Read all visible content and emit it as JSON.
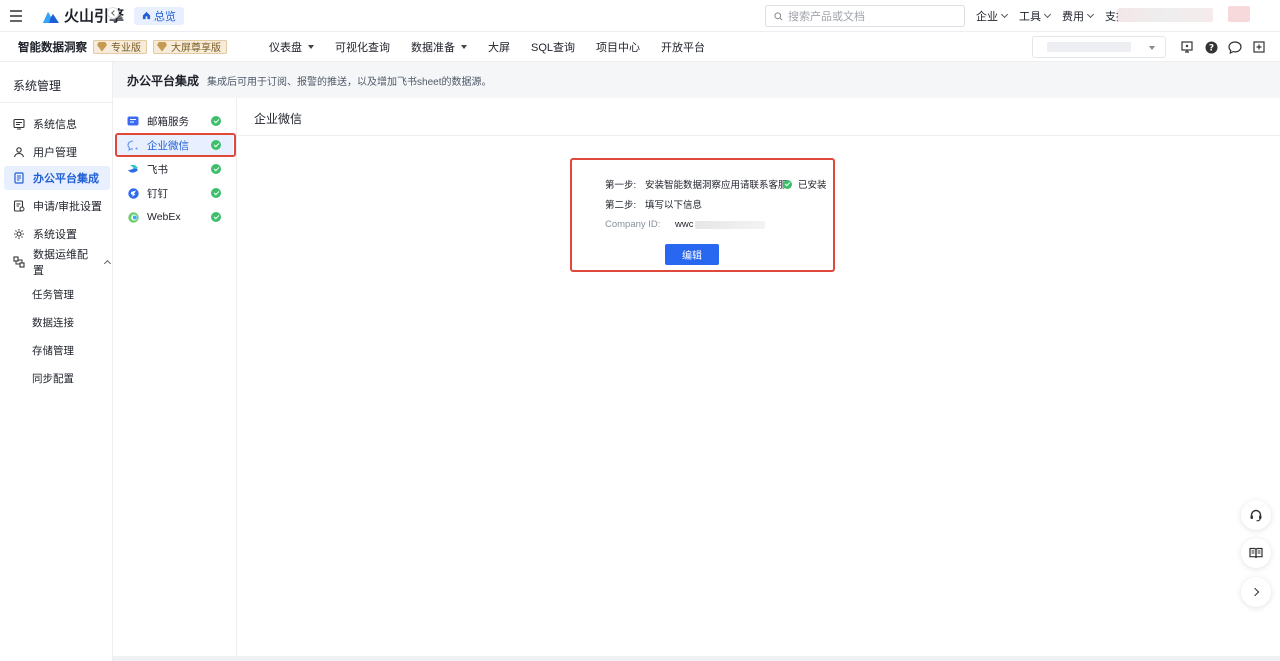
{
  "brand": {
    "name": "火山引擎",
    "home": "总览"
  },
  "search": {
    "placeholder": "搜索产品或文档"
  },
  "topnav": [
    {
      "label": "企业"
    },
    {
      "label": "工具"
    },
    {
      "label": "费用"
    },
    {
      "label": "支持"
    }
  ],
  "product": {
    "name": "智能数据洞察",
    "badges": [
      "专业版",
      "大屏尊享版"
    ]
  },
  "mainnav": [
    {
      "label": "仪表盘",
      "dropdown": true
    },
    {
      "label": "可视化查询"
    },
    {
      "label": "数据准备",
      "dropdown": true
    },
    {
      "label": "大屏"
    },
    {
      "label": "SQL查询"
    },
    {
      "label": "项目中心"
    },
    {
      "label": "开放平台"
    }
  ],
  "sidebar": {
    "title": "系统管理",
    "items": [
      {
        "label": "系统信息",
        "icon": "system-info-icon"
      },
      {
        "label": "用户管理",
        "icon": "users-icon"
      },
      {
        "label": "办公平台集成",
        "icon": "document-icon",
        "active": true
      },
      {
        "label": "申请/审批设置",
        "icon": "approval-icon"
      },
      {
        "label": "系统设置",
        "icon": "gear-icon"
      },
      {
        "label": "数据运维配置",
        "icon": "data-ops-icon",
        "expanded": true
      }
    ],
    "subitems": [
      "任务管理",
      "数据连接",
      "存储管理",
      "同步配置"
    ]
  },
  "page": {
    "title": "办公平台集成",
    "desc": "集成后可用于订阅、报警的推送，以及增加飞书sheet的数据源。"
  },
  "channels": [
    {
      "label": "邮箱服务",
      "icon": "mail-icon"
    },
    {
      "label": "企业微信",
      "icon": "wecom-icon",
      "active": true
    },
    {
      "label": "飞书",
      "icon": "feishu-icon"
    },
    {
      "label": "钉钉",
      "icon": "dingtalk-icon"
    },
    {
      "label": "WebEx",
      "icon": "webex-icon"
    }
  ],
  "content": {
    "title": "企业微信",
    "step1": {
      "label": "第一步:",
      "text": "安装智能数据洞察应用请联系客服",
      "status": "已安装"
    },
    "step2": {
      "label": "第二步:",
      "text": "填写以下信息"
    },
    "company_id": {
      "label": "Company ID:",
      "value": "wwc"
    },
    "edit": "编辑"
  },
  "colors": {
    "accent": "#2867f0",
    "success": "#3cbf6a",
    "highlight": "#e0483c"
  }
}
